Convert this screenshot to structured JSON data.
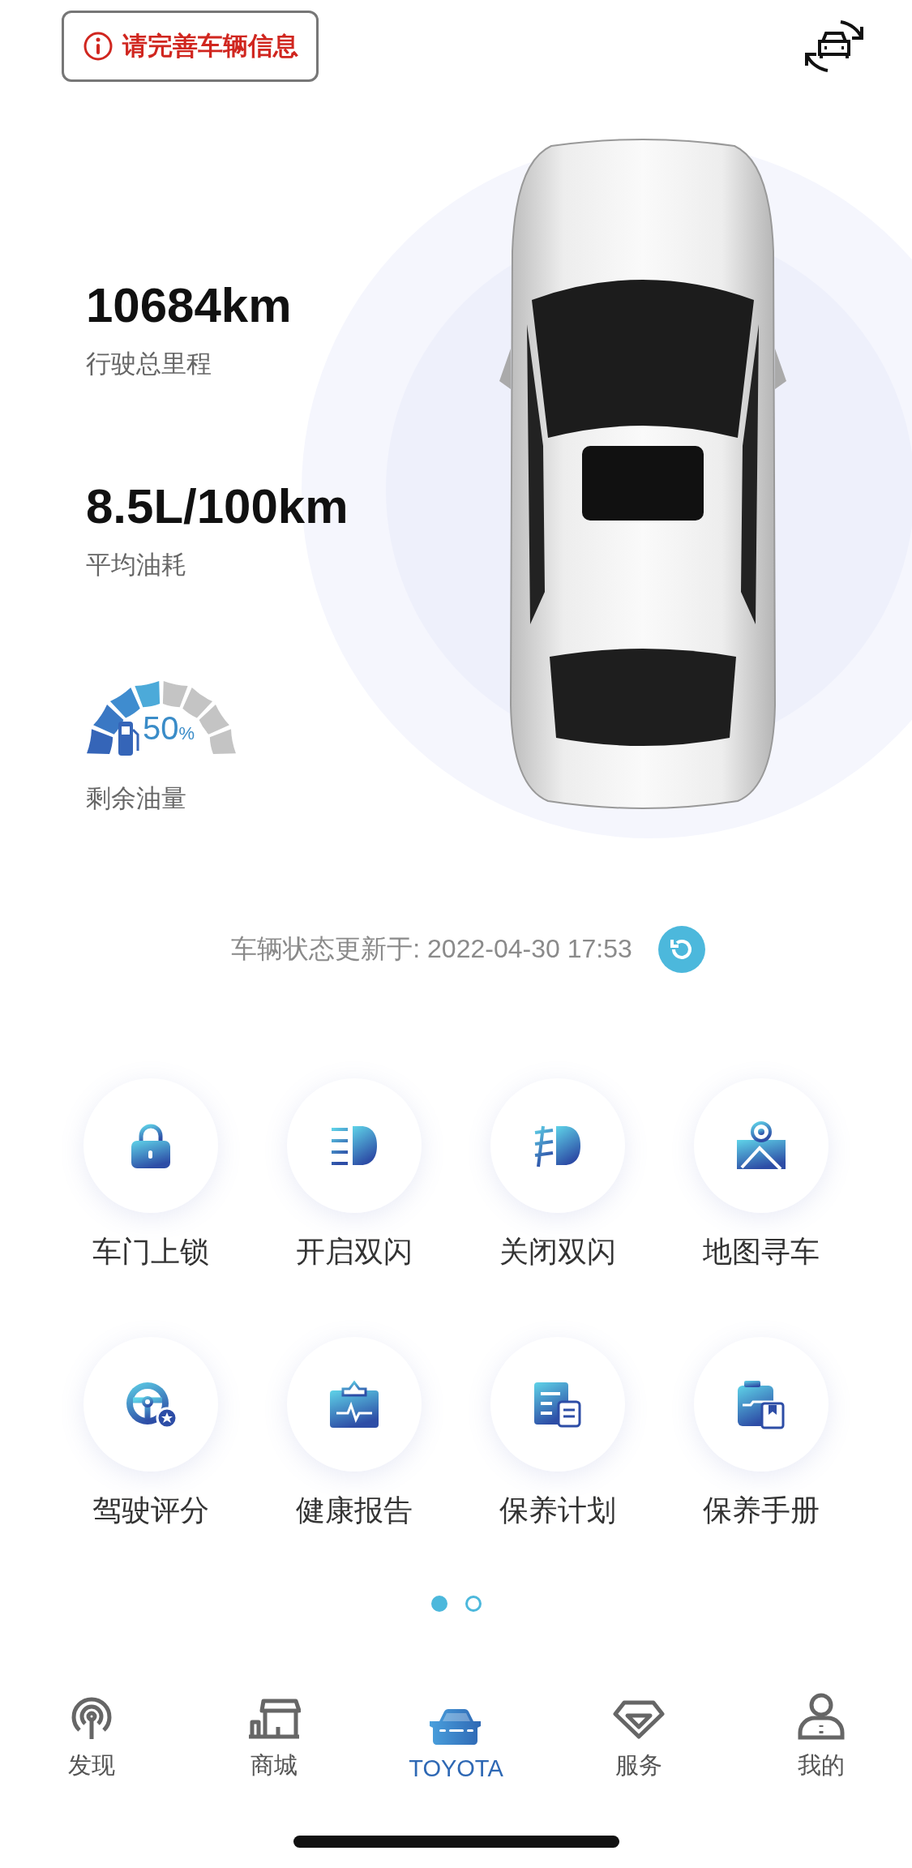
{
  "header": {
    "warning": "请完善车辆信息"
  },
  "stats": [
    {
      "value": "10684km",
      "label": "行驶总里程"
    },
    {
      "value": "8.5L/100km",
      "label": "平均油耗"
    }
  ],
  "fuel": {
    "level": 0.5,
    "reading": "50",
    "unit": "%",
    "label": "剩余油量"
  },
  "update": {
    "text": "车辆状态更新于: 2022-04-30 17:53"
  },
  "actions": [
    {
      "kind": "lock",
      "label": "车门上锁"
    },
    {
      "kind": "hazard-on",
      "label": "开启双闪"
    },
    {
      "kind": "hazard-off",
      "label": "关闭双闪"
    },
    {
      "kind": "map",
      "label": "地图寻车"
    },
    {
      "kind": "wheel",
      "label": "驾驶评分"
    },
    {
      "kind": "health",
      "label": "健康报告"
    },
    {
      "kind": "plan",
      "label": "保养计划"
    },
    {
      "kind": "manual",
      "label": "保养手册"
    }
  ],
  "pages": [
    {
      "selected": true
    },
    {
      "selected": false
    }
  ],
  "tabs": [
    {
      "kind": "discover",
      "label": "发现",
      "selected": false
    },
    {
      "kind": "shop",
      "label": "商城",
      "selected": false
    },
    {
      "kind": "car",
      "label": "TOYOTA",
      "selected": true
    },
    {
      "kind": "service",
      "label": "服务",
      "selected": false
    },
    {
      "kind": "me",
      "label": "我的",
      "selected": false
    }
  ]
}
